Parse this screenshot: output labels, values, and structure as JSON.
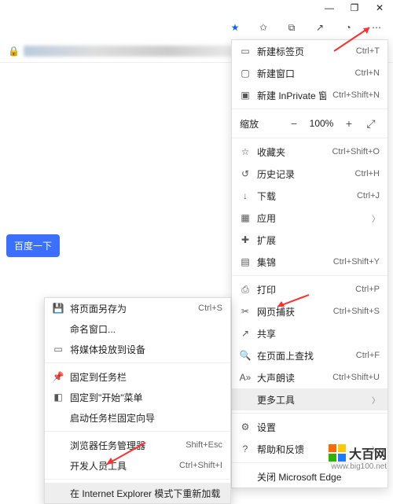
{
  "window_controls": {
    "minimize": "—",
    "restore": "❐",
    "close": "✕"
  },
  "toolbar": {
    "favorite_star": "★",
    "favorites_menu": "✩",
    "collections": "⧉",
    "share": "↗",
    "profile": "◔",
    "more": "⋯"
  },
  "baidu_button": "百度一下",
  "menu": {
    "new_tab": {
      "label": "新建标签页",
      "kbd": "Ctrl+T"
    },
    "new_window": {
      "label": "新建窗口",
      "kbd": "Ctrl+N"
    },
    "new_inprivate": {
      "label": "新建 InPrivate 窗口",
      "kbd": "Ctrl+Shift+N"
    },
    "zoom": {
      "label": "缩放",
      "minus": "−",
      "pct": "100%",
      "plus": "+",
      "full": "⤢"
    },
    "favorites": {
      "label": "收藏夹",
      "kbd": "Ctrl+Shift+O"
    },
    "history": {
      "label": "历史记录",
      "kbd": "Ctrl+H"
    },
    "downloads": {
      "label": "下载",
      "kbd": "Ctrl+J"
    },
    "apps": {
      "label": "应用"
    },
    "extensions": {
      "label": "扩展"
    },
    "collections": {
      "label": "集锦",
      "kbd": "Ctrl+Shift+Y"
    },
    "print": {
      "label": "打印",
      "kbd": "Ctrl+P"
    },
    "capture": {
      "label": "网页捕获",
      "kbd": "Ctrl+Shift+S"
    },
    "share": {
      "label": "共享"
    },
    "find": {
      "label": "在页面上查找",
      "kbd": "Ctrl+F"
    },
    "read_aloud": {
      "label": "大声朗读",
      "kbd": "Ctrl+Shift+U"
    },
    "more_tools": {
      "label": "更多工具"
    },
    "settings": {
      "label": "设置"
    },
    "help": {
      "label": "帮助和反馈"
    },
    "close_edge": {
      "label": "关闭 Microsoft Edge"
    }
  },
  "submenu": {
    "save_as": {
      "label": "将页面另存为",
      "kbd": "Ctrl+S"
    },
    "name_window": {
      "label": "命名窗口..."
    },
    "cast": {
      "label": "将媒体投放到设备"
    },
    "pin_taskbar": {
      "label": "固定到任务栏"
    },
    "pin_start": {
      "label": "固定到\"开始\"菜单"
    },
    "launch_wizard": {
      "label": "启动任务栏固定向导"
    },
    "task_manager": {
      "label": "浏览器任务管理器",
      "kbd": "Shift+Esc"
    },
    "dev_tools": {
      "label": "开发人员工具",
      "kbd": "Ctrl+Shift+I"
    },
    "ie_mode": {
      "label": "在 Internet Explorer 模式下重新加载"
    }
  },
  "watermark": {
    "name": "大百网",
    "url": "www.big100.net"
  }
}
